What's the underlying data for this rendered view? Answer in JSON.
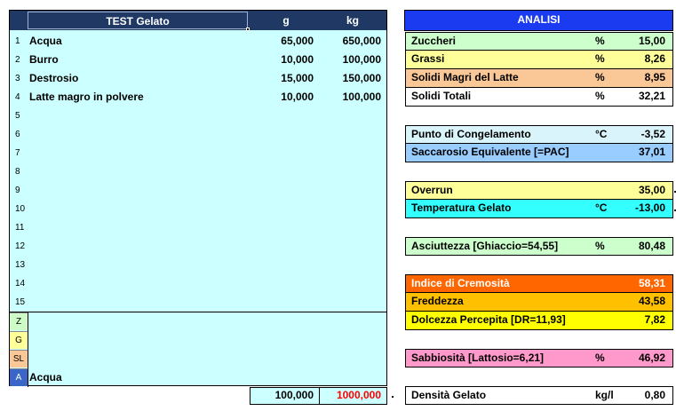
{
  "recipe": {
    "title": "TEST Gelato",
    "col_g": "g",
    "col_kg": "kg",
    "rows": [
      {
        "n": "1",
        "name": "Acqua",
        "g": "65,000",
        "kg": "650,000"
      },
      {
        "n": "2",
        "name": "Burro",
        "g": "10,000",
        "kg": "100,000"
      },
      {
        "n": "3",
        "name": "Destrosio",
        "g": "15,000",
        "kg": "150,000"
      },
      {
        "n": "4",
        "name": "Latte magro in polvere",
        "g": "10,000",
        "kg": "100,000"
      },
      {
        "n": "5",
        "name": "",
        "g": "",
        "kg": ""
      },
      {
        "n": "6",
        "name": "",
        "g": "",
        "kg": ""
      },
      {
        "n": "7",
        "name": "",
        "g": "",
        "kg": ""
      },
      {
        "n": "8",
        "name": "",
        "g": "",
        "kg": ""
      },
      {
        "n": "9",
        "name": "",
        "g": "",
        "kg": ""
      },
      {
        "n": "10",
        "name": "",
        "g": "",
        "kg": ""
      },
      {
        "n": "11",
        "name": "",
        "g": "",
        "kg": ""
      },
      {
        "n": "12",
        "name": "",
        "g": "",
        "kg": ""
      },
      {
        "n": "13",
        "name": "",
        "g": "",
        "kg": ""
      },
      {
        "n": "14",
        "name": "",
        "g": "",
        "kg": ""
      },
      {
        "n": "15",
        "name": "",
        "g": "",
        "kg": ""
      }
    ],
    "tags": [
      {
        "label": "Z",
        "color": "#cdfac6"
      },
      {
        "label": "G",
        "color": "#ffff99"
      },
      {
        "label": "SL",
        "color": "#fac896"
      },
      {
        "label": "A",
        "color": "#3a67c7"
      }
    ],
    "a_value": "Acqua",
    "total_g": "100,000",
    "total_kg": "1000,000",
    "total_kg_color": "#ff0000"
  },
  "analysis": {
    "title": "ANALISI",
    "header_color": "#1a3bf0",
    "groups": [
      [
        {
          "label": "Zuccheri",
          "unit": "%",
          "value": "15,00",
          "color": "#ccffcc"
        },
        {
          "label": "Grassi",
          "unit": "%",
          "value": "8,26",
          "color": "#ffff99"
        },
        {
          "label": "Solidi Magri del Latte",
          "unit": "%",
          "value": "8,95",
          "color": "#fac896"
        },
        {
          "label": "Solidi Totali",
          "unit": "%",
          "value": "32,21",
          "color": "#ffffff"
        }
      ],
      [
        {
          "label": "Punto di Congelamento",
          "unit": "°C",
          "value": "-3,52",
          "color": "#d9f4fa"
        },
        {
          "label": "Saccarosio Equivalente [=PAC]",
          "unit": "",
          "value": "37,01",
          "color": "#99ccff"
        }
      ],
      [
        {
          "label": "Overrun",
          "unit": "",
          "value": "35,00",
          "color": "#ffff99"
        },
        {
          "label": "Temperatura Gelato",
          "unit": "°C",
          "value": "-13,00",
          "color": "#33ffff"
        }
      ],
      [
        {
          "label": "Asciuttezza [Ghiaccio=54,55]",
          "unit": "%",
          "value": "80,48",
          "color": "#ccffcc"
        }
      ],
      [
        {
          "label": "Indice di Cremosità",
          "unit": "",
          "value": "58,31",
          "color": "#ff6600",
          "text_color": "#ffffff"
        },
        {
          "label": "Freddezza",
          "unit": "",
          "value": "43,58",
          "color": "#ffc000"
        },
        {
          "label": "Dolcezza Percepita [DR=11,93]",
          "unit": "",
          "value": "7,82",
          "color": "#ffff00"
        }
      ],
      [
        {
          "label": "Sabbiosità [Lattosio=6,21]",
          "unit": "%",
          "value": "46,92",
          "color": "#ff99cc"
        }
      ],
      [
        {
          "label": "Densità Gelato",
          "unit": "kg/l",
          "value": "0,80",
          "color": "#ffffff"
        }
      ]
    ]
  }
}
